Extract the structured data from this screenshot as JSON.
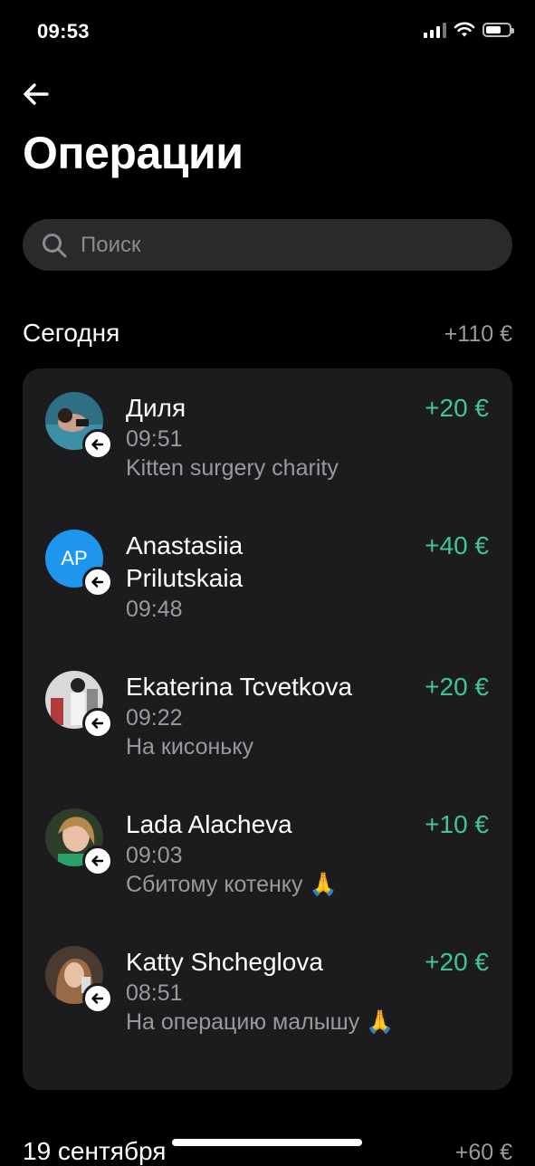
{
  "status_bar": {
    "time": "09:53"
  },
  "header": {
    "title": "Операции"
  },
  "search": {
    "placeholder": "Поиск"
  },
  "sections": [
    {
      "title": "Сегодня",
      "total": "+110 €"
    },
    {
      "title": "19 сентября",
      "total": "+60 €"
    }
  ],
  "transactions": [
    {
      "name": "Диля",
      "time": "09:51",
      "note": "Kitten surgery charity",
      "amount": "+20 €"
    },
    {
      "name": "Anastasiia Prilutskaia",
      "initials": "AP",
      "time": "09:48",
      "note": "",
      "amount": "+40 €"
    },
    {
      "name": "Ekaterina Tcvetkova",
      "time": "09:22",
      "note": "На кисоньку",
      "amount": "+20 €"
    },
    {
      "name": "Lada Alacheva",
      "time": "09:03",
      "note": "Сбитому котенку 🙏",
      "amount": "+10 €"
    },
    {
      "name": "Katty Shcheglova",
      "time": "08:51",
      "note": "На операцию малышу 🙏",
      "amount": "+20 €"
    }
  ],
  "colors": {
    "background": "#000000",
    "card": "#1c1c1e",
    "positive_amount": "#3ec59a",
    "secondary_text": "#9a9a9e",
    "avatar_initials_bg": "#1e96ee"
  },
  "icons": {
    "back": "arrow-left-icon",
    "search": "search-icon",
    "incoming": "arrow-left-circle-icon",
    "signal": "cellular-signal-icon",
    "wifi": "wifi-icon",
    "battery": "battery-icon"
  }
}
